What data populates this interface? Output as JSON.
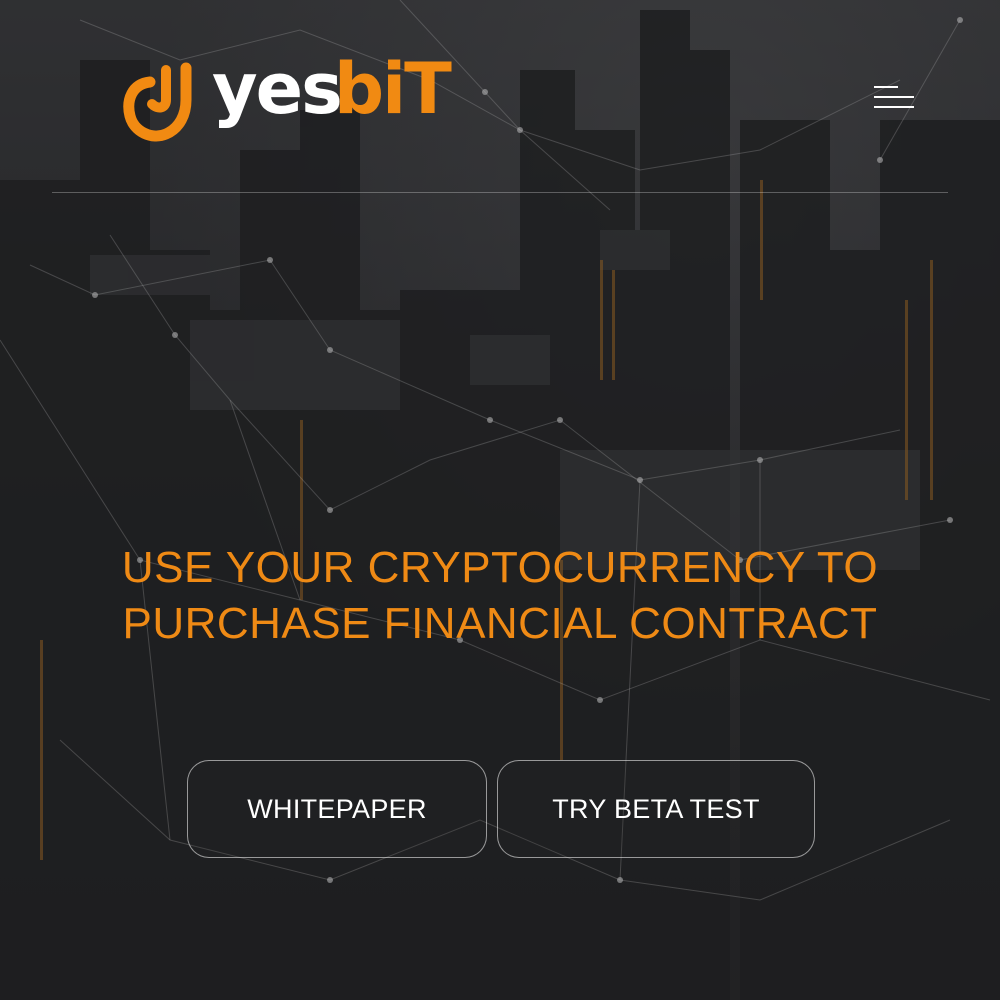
{
  "brand": {
    "logo_text_yes": "yes",
    "logo_text_bit": "biT",
    "accent_color": "#f18a12",
    "text_color": "#ffffff"
  },
  "header": {
    "menu_icon": "hamburger-menu-icon"
  },
  "hero": {
    "headline_line1": "USE YOUR CRYPTOCURRENCY TO",
    "headline_line2": "PURCHASE FINANCIAL CONTRACT"
  },
  "actions": {
    "whitepaper_label": "WHITEPAPER",
    "beta_label": "TRY BETA TEST"
  }
}
